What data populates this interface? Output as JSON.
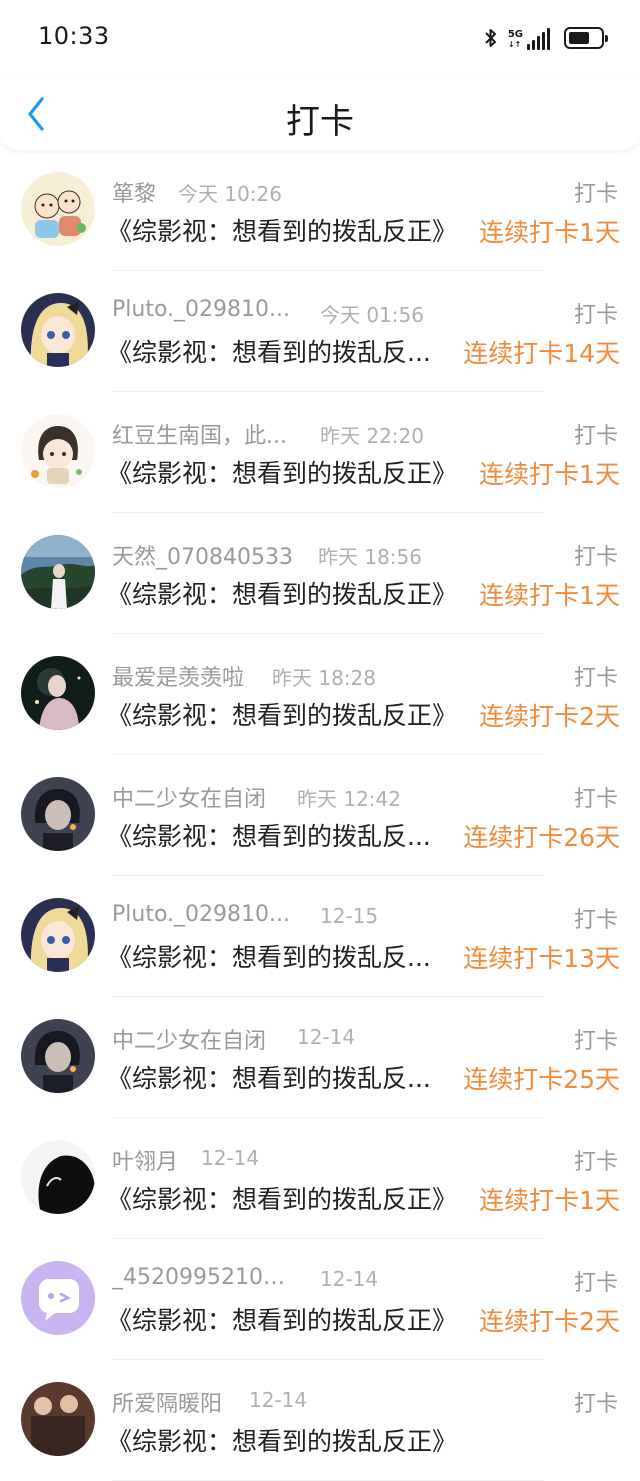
{
  "status_bar": {
    "time": "10:33",
    "network": "5G"
  },
  "header": {
    "title": "打卡"
  },
  "colors": {
    "streak": "#f08a3c",
    "meta": "#9a9a9a",
    "accent_blue": "#1a9bfc"
  },
  "items": [
    {
      "name": "箪黎",
      "time": "今天 10:26",
      "tag": "打卡",
      "book": "《综影视：想看到的拨乱反正》",
      "streak": "连续打卡1天"
    },
    {
      "name": "Pluto._029810...",
      "time": "今天 01:56",
      "tag": "打卡",
      "book": "《综影视：想看到的拨乱反...",
      "streak": "连续打卡14天"
    },
    {
      "name": "红豆生南国，此...",
      "time": "昨天 22:20",
      "tag": "打卡",
      "book": "《综影视：想看到的拨乱反正》",
      "streak": "连续打卡1天"
    },
    {
      "name": "天然_070840533",
      "time": "昨天 18:56",
      "tag": "打卡",
      "book": "《综影视：想看到的拨乱反正》",
      "streak": "连续打卡1天"
    },
    {
      "name": "最爱是羡羡啦",
      "time": "昨天 18:28",
      "tag": "打卡",
      "book": "《综影视：想看到的拨乱反正》",
      "streak": "连续打卡2天"
    },
    {
      "name": "中二少女在自闭",
      "time": "昨天 12:42",
      "tag": "打卡",
      "book": "《综影视：想看到的拨乱反...",
      "streak": "连续打卡26天"
    },
    {
      "name": "Pluto._029810...",
      "time": "12-15",
      "tag": "打卡",
      "book": "《综影视：想看到的拨乱反...",
      "streak": "连续打卡13天"
    },
    {
      "name": "中二少女在自闭",
      "time": "12-14",
      "tag": "打卡",
      "book": "《综影视：想看到的拨乱反...",
      "streak": "连续打卡25天"
    },
    {
      "name": "叶翎月",
      "time": "12-14",
      "tag": "打卡",
      "book": "《综影视：想看到的拨乱反正》",
      "streak": "连续打卡1天"
    },
    {
      "name": "_45209952100...",
      "time": "12-14",
      "tag": "打卡",
      "book": "《综影视：想看到的拨乱反正》",
      "streak": "连续打卡2天"
    },
    {
      "name": "所爱隔暖阳",
      "time": "12-14",
      "tag": "打卡",
      "book": "《综影视：想看到的拨乱反正》",
      "streak": ""
    }
  ]
}
